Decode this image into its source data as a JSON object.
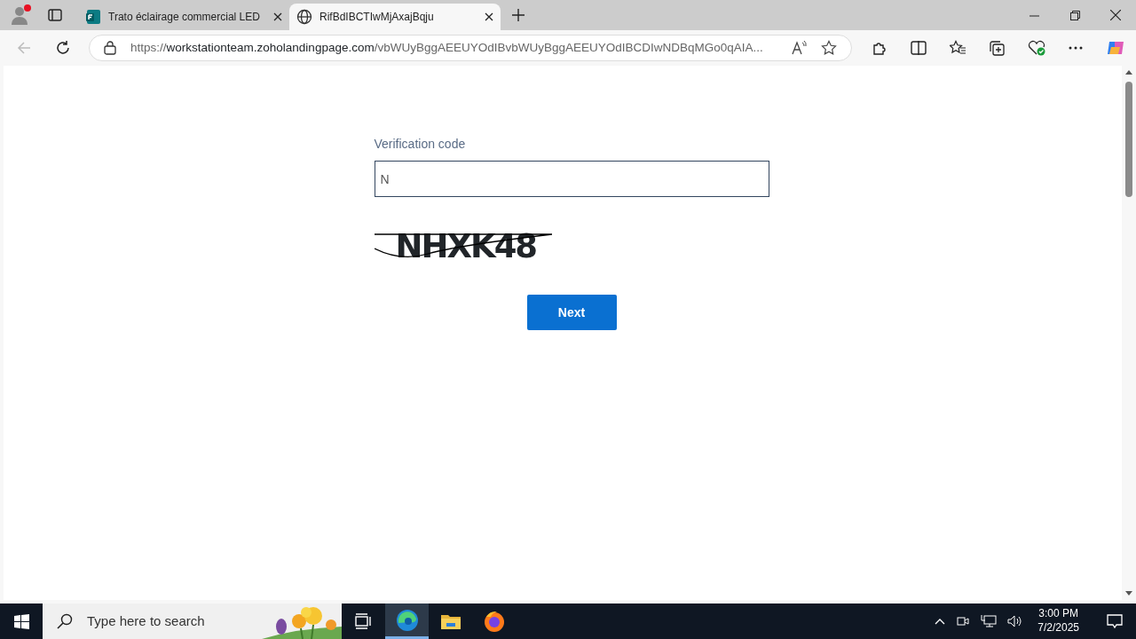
{
  "browser": {
    "tabs": [
      {
        "title": "Trato éclairage commercial LED",
        "kind": "forms",
        "selected": false
      },
      {
        "title": "RifBdIBCTIwMjAxajBqju",
        "kind": "globe",
        "selected": true
      }
    ],
    "address": {
      "scheme": "https://",
      "host": "workstationteam.zoholandingpage.com",
      "path": "/vbWUyBggAEEUYOdIBvbWUyBggAEEUYOdIBCDIwNDBqMGo0qAIA..."
    }
  },
  "form": {
    "label": "Verification code",
    "value": "N",
    "focused": true,
    "captcha": "NHXK48",
    "button": "Next"
  },
  "taskbar": {
    "search_placeholder": "Type here to search",
    "apps": [
      {
        "kind": "taskview",
        "selected": false
      },
      {
        "kind": "edge",
        "selected": true
      },
      {
        "kind": "explorer",
        "selected": false
      },
      {
        "kind": "firefox",
        "selected": false
      }
    ],
    "time": "3:00 PM",
    "date": "7/2/2025"
  }
}
